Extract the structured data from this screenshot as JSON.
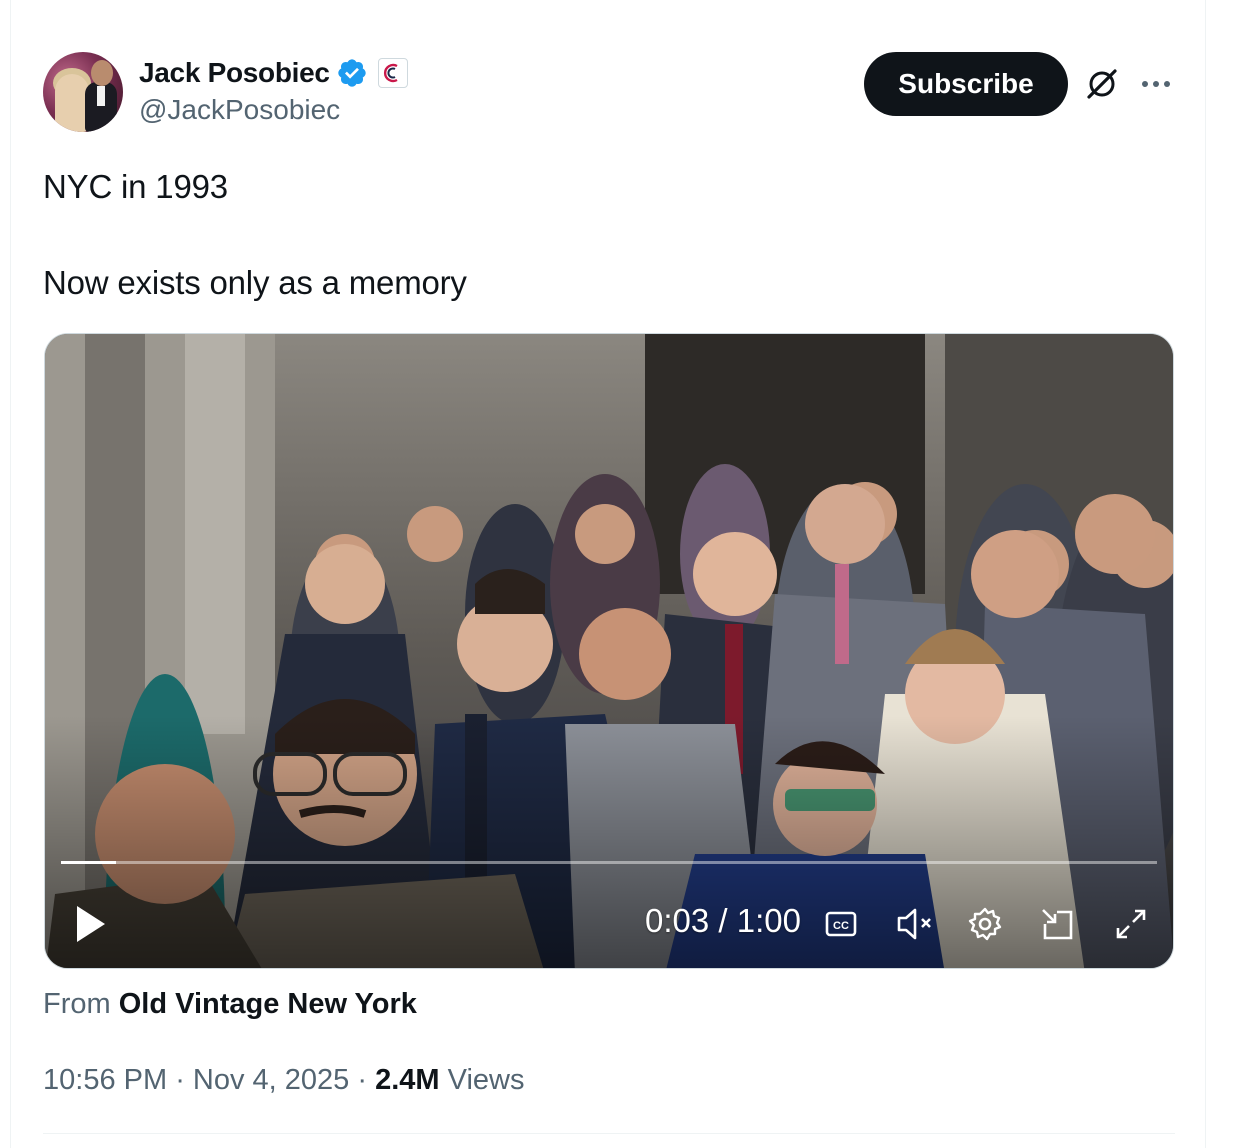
{
  "author": {
    "name": "Jack Posobiec",
    "handle": "@JackPosobiec",
    "avatar_icon": "profile-photo",
    "verified_badge_color": "#1d9bf0"
  },
  "actions": {
    "subscribe_label": "Subscribe",
    "grok_icon": "grok-icon",
    "more_icon": "more-icon"
  },
  "post": {
    "line1": "NYC in 1993",
    "line2": "Now exists only as a memory"
  },
  "video": {
    "time": "0:03 / 1:00",
    "progress_fraction": 0.05,
    "controls": [
      "play-icon",
      "captions-icon",
      "mute-icon",
      "settings-icon",
      "picture-in-picture-icon",
      "fullscreen-icon"
    ]
  },
  "source": {
    "prefix": "From",
    "name": "Old Vintage New York"
  },
  "meta": {
    "time": "10:56 PM",
    "sep1": " · ",
    "date": "Nov 4, 2025",
    "sep2": " · ",
    "views_count": "2.4M",
    "views_label": " Views"
  },
  "colors": {
    "text": "#0f1419",
    "secondary": "#536471",
    "button_bg": "#0f1419",
    "accent": "#1d9bf0"
  }
}
